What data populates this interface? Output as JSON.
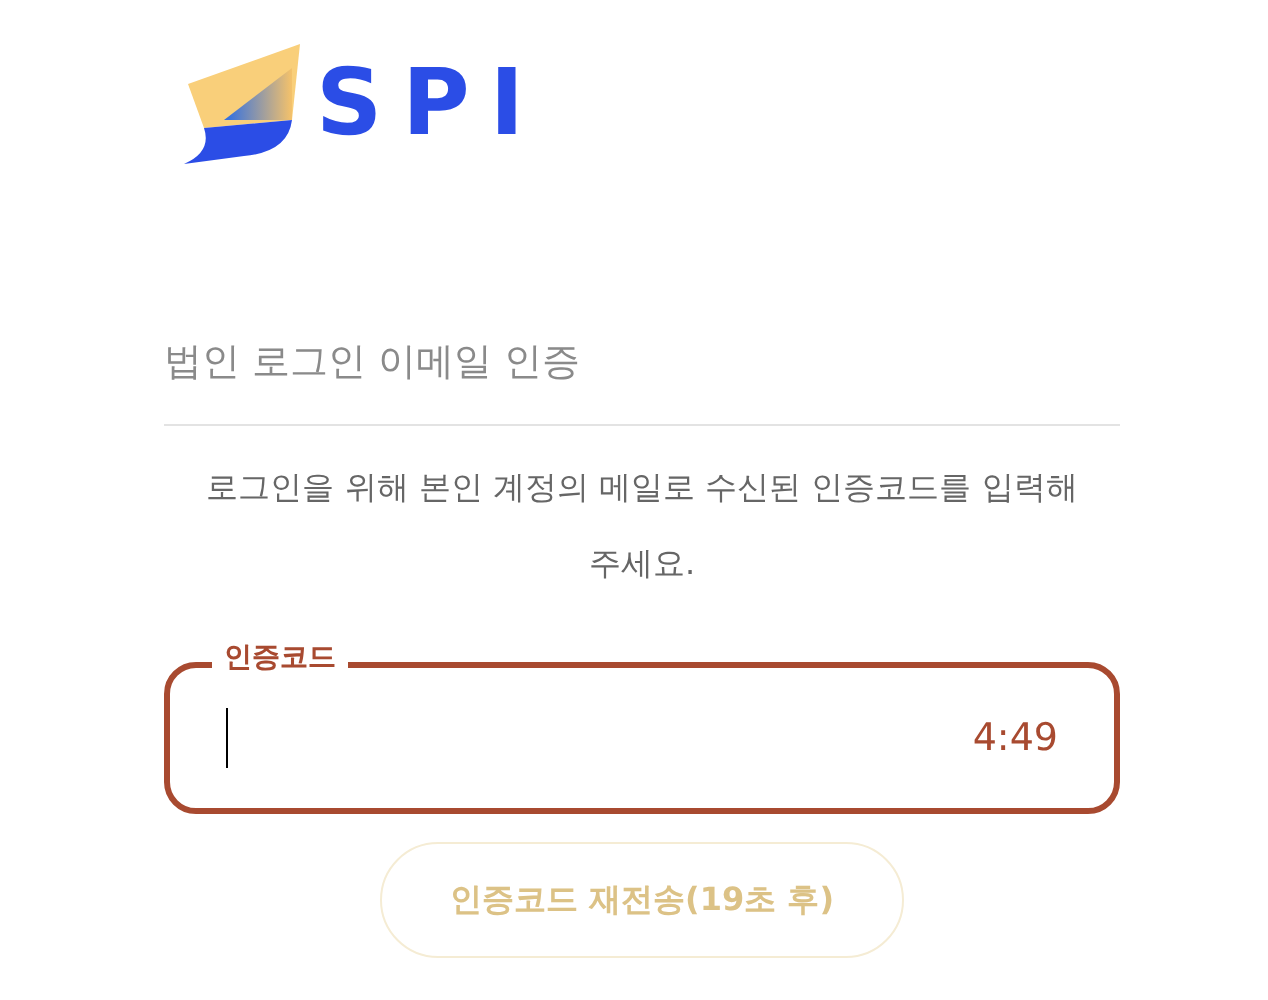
{
  "logo": {
    "text": "SPI"
  },
  "title": "법인 로그인 이메일 인증",
  "instruction": "로그인을 위해 본인 계정의 메일로 수신된 인증코드를 입력해 주세요.",
  "code_field": {
    "label": "인증코드",
    "timer": "4:49",
    "focused": true
  },
  "resend_button": {
    "label": "인증코드 재전송(19초 후)",
    "disabled": true
  }
}
